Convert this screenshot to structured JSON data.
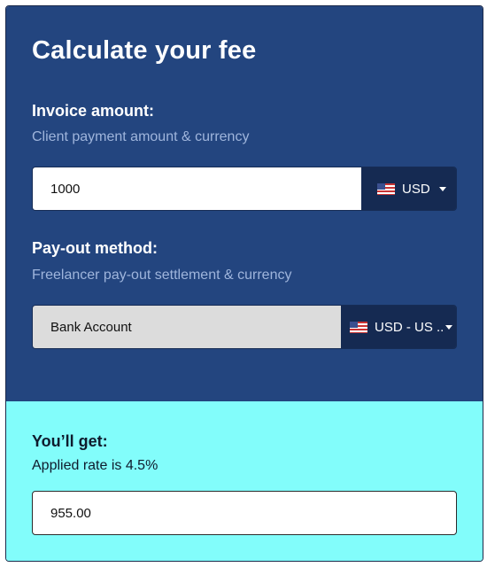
{
  "calculator": {
    "title": "Calculate your fee",
    "invoice": {
      "label": "Invoice amount:",
      "sublabel": "Client payment amount & currency",
      "amount_value": "1000",
      "currency": "USD",
      "currency_flag": "us-flag-icon"
    },
    "payout": {
      "label": "Pay-out method:",
      "sublabel": "Freelancer pay-out settlement & currency",
      "method_value": "Bank Account",
      "currency": "USD - US ..",
      "currency_flag": "us-flag-icon"
    },
    "result": {
      "label": "You’ll get:",
      "rate_text": "Applied rate is 4.5%",
      "value": "955.00"
    }
  },
  "colors": {
    "top_panel": "#23457f",
    "bottom_panel": "#82fdfb",
    "select_bg": "#152a52",
    "sublabel": "#9fb5dc"
  }
}
